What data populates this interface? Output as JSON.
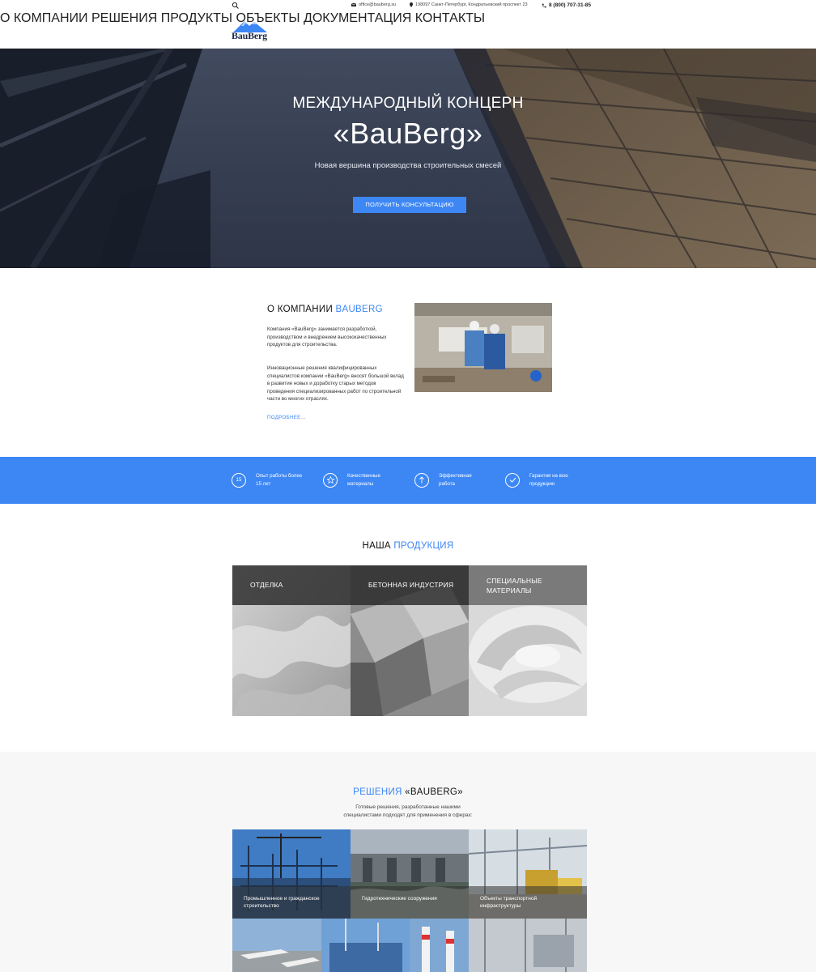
{
  "topbar": {
    "email": "office@bauberg.su",
    "address": "198097 Санкт-Петербург, Кондратьевский проспект 23",
    "phone": "8 (800) 707-31-85"
  },
  "logo": {
    "text": "BauBerg"
  },
  "nav": {
    "items": [
      "О КОМПАНИИ",
      "РЕШЕНИЯ",
      "ПРОДУКТЫ",
      "ОБЪЕКТЫ",
      "ДОКУМЕНТАЦИЯ",
      "КОНТАКТЫ"
    ]
  },
  "hero": {
    "title1": "МЕЖДУНАРОДНЫЙ КОНЦЕРН",
    "title2": "«BauBerg»",
    "subtitle": "Новая вершина производства строительных смесей",
    "button": "ПОЛУЧИТЬ КОНСУЛЬТАЦИЮ"
  },
  "about": {
    "title_plain": "О КОМПАНИИ ",
    "title_accent": "BAUBERG",
    "p1": "Компания «BauBerg» занимается разработкой, производством и внедрением высококачественных продуктов для строительства.",
    "p2": "Инновационные решения квалифицированных специалистов компании «BauBerg» вносят большой вклад в развитие новых и доработку старых методов проведения специализированных работ по строительной части во многих отраслях.",
    "more": "ПОДРОБНЕЕ..."
  },
  "features": [
    {
      "icon": "15",
      "label": "Опыт работы более 15 лет"
    },
    {
      "icon": "star",
      "label": "Качественные материалы"
    },
    {
      "icon": "arrow-up",
      "label": "Эффективная работа"
    },
    {
      "icon": "check",
      "label": "Гарантия на всю продукцию"
    }
  ],
  "products": {
    "title_plain": "НАША ",
    "title_accent": "ПРОДУКЦИЯ",
    "items": [
      "ОТДЕЛКА",
      "БЕТОННАЯ ИНДУСТРИЯ",
      "СПЕЦИАЛЬНЫЕ МАТЕРИАЛЫ"
    ]
  },
  "solutions": {
    "title_accent": "РЕШЕНИЯ",
    "title_plain": " «BAUBERG»",
    "subtitle": "Готовые решения, разработанные нашими специалистами подходят для применения в сферах:",
    "items": [
      "Промышленное и гражданское строительство",
      "Гидротехнические сооружения",
      "Объекты транспортной инфраструктуры"
    ]
  },
  "colors": {
    "accent": "#3d87f5"
  }
}
